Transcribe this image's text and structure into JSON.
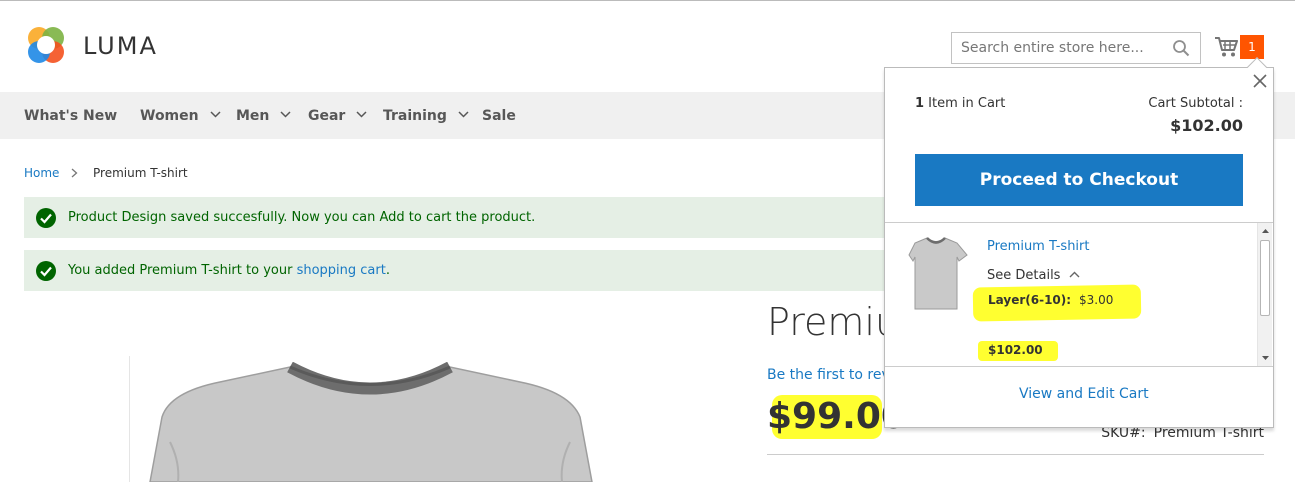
{
  "header": {
    "logo_text": "LUMA",
    "search_placeholder": "Search entire store here...",
    "cart_count": "1"
  },
  "nav": {
    "items": [
      {
        "label": "What's New",
        "dropdown": false
      },
      {
        "label": "Women",
        "dropdown": true
      },
      {
        "label": "Men",
        "dropdown": true
      },
      {
        "label": "Gear",
        "dropdown": true
      },
      {
        "label": "Training",
        "dropdown": true
      },
      {
        "label": "Sale",
        "dropdown": false
      }
    ]
  },
  "breadcrumb": {
    "home": "Home",
    "separator": ">",
    "current": "Premium T-shirt"
  },
  "messages": [
    {
      "text": "Product Design saved succesfully. Now you can Add to cart the product."
    },
    {
      "text_before": "You added Premium T-shirt to your ",
      "link": "shopping cart",
      "text_after": "."
    }
  ],
  "product": {
    "title": "Premiu",
    "review_link": "Be the first to revi",
    "price": "$99.00",
    "sku_label": "SKU#:",
    "sku_value": "Premium T-shirt"
  },
  "minicart": {
    "count_number": "1",
    "count_text": " Item in Cart",
    "subtotal_label": "Cart Subtotal :",
    "subtotal_value": "$102.00",
    "checkout_label": "Proceed to Checkout",
    "item": {
      "name": "Premium T-shirt",
      "see_details": "See Details",
      "option_label": "Layer(6-10):",
      "option_value": "$3.00",
      "line_price": "$102.00"
    },
    "view_edit_label": "View and Edit Cart"
  },
  "colors": {
    "accent_blue": "#1979c3",
    "cart_badge": "#ff5501",
    "success_bg": "#e5efe5",
    "success_text": "#006400",
    "highlight": "#ffff30"
  }
}
